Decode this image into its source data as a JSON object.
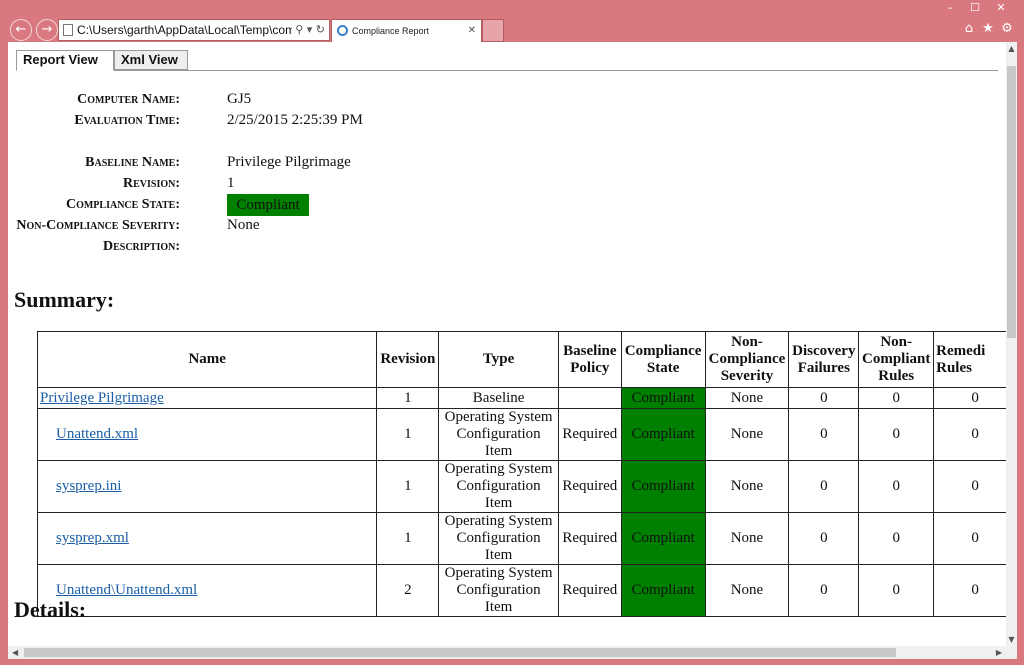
{
  "browser": {
    "address": "C:\\Users\\garth\\AppData\\Local\\Temp\\com",
    "tab_title": "Compliance Report",
    "tools": "⚲ ▾ ↻",
    "tab_close": "✕"
  },
  "window_controls": {
    "minimize": "–",
    "maximize": "☐",
    "close": "✕"
  },
  "toolbar_icons": [
    "home-icon",
    "star-icon",
    "gear-icon"
  ],
  "report_tabs": [
    "Report View",
    "Xml View"
  ],
  "properties": {
    "computer_name_label": "Computer Name:",
    "computer_name": "GJ5",
    "evaluation_time_label": "Evaluation Time:",
    "evaluation_time": "2/25/2015 2:25:39 PM",
    "baseline_name_label": "Baseline Name:",
    "baseline_name": "Privilege Pilgrimage",
    "revision_label": "Revision:",
    "revision": "1",
    "compliance_state_label": "Compliance State:",
    "compliance_state": "Compliant",
    "severity_label": "Non-Compliance Severity:",
    "severity": "None",
    "description_label": "Description:"
  },
  "sections": {
    "summary": "Summary:",
    "details": "Details:"
  },
  "table": {
    "headers": [
      "Name",
      "Revision",
      "Type",
      "Baseline Policy",
      "Compliance State",
      "Non-Compliance Severity",
      "Discovery Failures",
      "Non-Compliant Rules",
      "Remedi Rules"
    ],
    "rows": [
      {
        "name": "Privilege Pilgrimage",
        "revision": "1",
        "type": "Baseline",
        "policy": "",
        "state": "Compliant",
        "severity": "None",
        "discovery": "0",
        "noncompliant": "0",
        "remed": "0"
      },
      {
        "name": "Unattend.xml",
        "revision": "1",
        "type": "Operating System Configuration Item",
        "policy": "Required",
        "state": "Compliant",
        "severity": "None",
        "discovery": "0",
        "noncompliant": "0",
        "remed": "0"
      },
      {
        "name": "sysprep.ini",
        "revision": "1",
        "type": "Operating System Configuration Item",
        "policy": "Required",
        "state": "Compliant",
        "severity": "None",
        "discovery": "0",
        "noncompliant": "0",
        "remed": "0"
      },
      {
        "name": "sysprep.xml",
        "revision": "1",
        "type": "Operating System Configuration Item",
        "policy": "Required",
        "state": "Compliant",
        "severity": "None",
        "discovery": "0",
        "noncompliant": "0",
        "remed": "0"
      },
      {
        "name": "Unattend\\Unattend.xml",
        "revision": "2",
        "type": "Operating System Configuration Item",
        "policy": "Required",
        "state": "Compliant",
        "severity": "None",
        "discovery": "0",
        "noncompliant": "0",
        "remed": "0"
      }
    ]
  },
  "colors": {
    "chrome": "#d9787f",
    "compliant": "#008000",
    "link": "#1a5ea8"
  }
}
